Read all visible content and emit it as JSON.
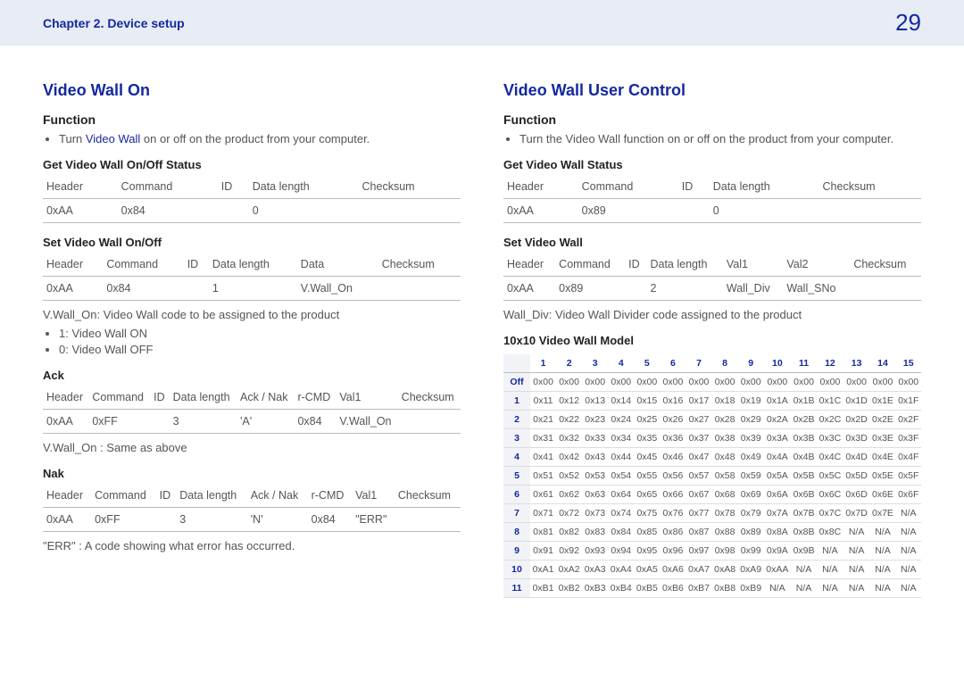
{
  "header": {
    "chapter": "Chapter 2. Device setup",
    "page": "29"
  },
  "left": {
    "title": "Video Wall On",
    "function_heading": "Function",
    "function_bullet_prefix": "Turn ",
    "function_bullet_brand": "Video Wall",
    "function_bullet_suffix": " on or off on the product from your computer.",
    "get_heading": "Get Video Wall On/Off Status",
    "get_headers": [
      "Header",
      "Command",
      "ID",
      "Data length",
      "Checksum"
    ],
    "get_row": [
      "0xAA",
      "0x84",
      "",
      "0",
      ""
    ],
    "set_heading": "Set Video Wall On/Off",
    "set_headers": [
      "Header",
      "Command",
      "ID",
      "Data length",
      "Data",
      "Checksum"
    ],
    "set_row": [
      "0xAA",
      "0x84",
      "",
      "1",
      "V.Wall_On",
      ""
    ],
    "set_note": "V.Wall_On: Video Wall code to be assigned to the product",
    "set_bullet1": "1: Video Wall ON",
    "set_bullet2": "0: Video Wall OFF",
    "ack_heading": "Ack",
    "ack_headers": [
      "Header",
      "Command",
      "ID",
      "Data length",
      "Ack / Nak",
      "r-CMD",
      "Val1",
      "Checksum"
    ],
    "ack_row": [
      "0xAA",
      "0xFF",
      "",
      "3",
      "'A'",
      "0x84",
      "V.Wall_On",
      ""
    ],
    "ack_note": "V.Wall_On : Same as above",
    "nak_heading": "Nak",
    "nak_headers": [
      "Header",
      "Command",
      "ID",
      "Data length",
      "Ack / Nak",
      "r-CMD",
      "Val1",
      "Checksum"
    ],
    "nak_row": [
      "0xAA",
      "0xFF",
      "",
      "3",
      "'N'",
      "0x84",
      "\"ERR\"",
      ""
    ],
    "nak_note": "\"ERR\" : A code showing what error has occurred."
  },
  "right": {
    "title": "Video Wall User Control",
    "function_heading": "Function",
    "function_bullet": "Turn the Video Wall function on or off on the product from your computer.",
    "get_heading": "Get Video Wall Status",
    "get_headers": [
      "Header",
      "Command",
      "ID",
      "Data length",
      "Checksum"
    ],
    "get_row": [
      "0xAA",
      "0x89",
      "",
      "0",
      ""
    ],
    "set_heading": "Set Video Wall",
    "set_headers": [
      "Header",
      "Command",
      "ID",
      "Data length",
      "Val1",
      "Val2",
      "Checksum"
    ],
    "set_row": [
      "0xAA",
      "0x89",
      "",
      "2",
      "Wall_Div",
      "Wall_SNo",
      ""
    ],
    "set_note": "Wall_Div: Video Wall Divider code assigned to the product",
    "model_heading": "10x10 Video Wall Model"
  },
  "matrix": {
    "col_headers": [
      "1",
      "2",
      "3",
      "4",
      "5",
      "6",
      "7",
      "8",
      "9",
      "10",
      "11",
      "12",
      "13",
      "14",
      "15"
    ],
    "row_headers": [
      "Off",
      "1",
      "2",
      "3",
      "4",
      "5",
      "6",
      "7",
      "8",
      "9",
      "10",
      "11"
    ]
  },
  "chart_data": {
    "type": "table",
    "title": "10x10 Video Wall Model",
    "columns": [
      "1",
      "2",
      "3",
      "4",
      "5",
      "6",
      "7",
      "8",
      "9",
      "10",
      "11",
      "12",
      "13",
      "14",
      "15"
    ],
    "row_labels": [
      "Off",
      "1",
      "2",
      "3",
      "4",
      "5",
      "6",
      "7",
      "8",
      "9",
      "10",
      "11"
    ],
    "rows": [
      [
        "0x00",
        "0x00",
        "0x00",
        "0x00",
        "0x00",
        "0x00",
        "0x00",
        "0x00",
        "0x00",
        "0x00",
        "0x00",
        "0x00",
        "0x00",
        "0x00",
        "0x00"
      ],
      [
        "0x11",
        "0x12",
        "0x13",
        "0x14",
        "0x15",
        "0x16",
        "0x17",
        "0x18",
        "0x19",
        "0x1A",
        "0x1B",
        "0x1C",
        "0x1D",
        "0x1E",
        "0x1F"
      ],
      [
        "0x21",
        "0x22",
        "0x23",
        "0x24",
        "0x25",
        "0x26",
        "0x27",
        "0x28",
        "0x29",
        "0x2A",
        "0x2B",
        "0x2C",
        "0x2D",
        "0x2E",
        "0x2F"
      ],
      [
        "0x31",
        "0x32",
        "0x33",
        "0x34",
        "0x35",
        "0x36",
        "0x37",
        "0x38",
        "0x39",
        "0x3A",
        "0x3B",
        "0x3C",
        "0x3D",
        "0x3E",
        "0x3F"
      ],
      [
        "0x41",
        "0x42",
        "0x43",
        "0x44",
        "0x45",
        "0x46",
        "0x47",
        "0x48",
        "0x49",
        "0x4A",
        "0x4B",
        "0x4C",
        "0x4D",
        "0x4E",
        "0x4F"
      ],
      [
        "0x51",
        "0x52",
        "0x53",
        "0x54",
        "0x55",
        "0x56",
        "0x57",
        "0x58",
        "0x59",
        "0x5A",
        "0x5B",
        "0x5C",
        "0x5D",
        "0x5E",
        "0x5F"
      ],
      [
        "0x61",
        "0x62",
        "0x63",
        "0x64",
        "0x65",
        "0x66",
        "0x67",
        "0x68",
        "0x69",
        "0x6A",
        "0x6B",
        "0x6C",
        "0x6D",
        "0x6E",
        "0x6F"
      ],
      [
        "0x71",
        "0x72",
        "0x73",
        "0x74",
        "0x75",
        "0x76",
        "0x77",
        "0x78",
        "0x79",
        "0x7A",
        "0x7B",
        "0x7C",
        "0x7D",
        "0x7E",
        "N/A"
      ],
      [
        "0x81",
        "0x82",
        "0x83",
        "0x84",
        "0x85",
        "0x86",
        "0x87",
        "0x88",
        "0x89",
        "0x8A",
        "0x8B",
        "0x8C",
        "N/A",
        "N/A",
        "N/A"
      ],
      [
        "0x91",
        "0x92",
        "0x93",
        "0x94",
        "0x95",
        "0x96",
        "0x97",
        "0x98",
        "0x99",
        "0x9A",
        "0x9B",
        "N/A",
        "N/A",
        "N/A",
        "N/A"
      ],
      [
        "0xA1",
        "0xA2",
        "0xA3",
        "0xA4",
        "0xA5",
        "0xA6",
        "0xA7",
        "0xA8",
        "0xA9",
        "0xAA",
        "N/A",
        "N/A",
        "N/A",
        "N/A",
        "N/A"
      ],
      [
        "0xB1",
        "0xB2",
        "0xB3",
        "0xB4",
        "0xB5",
        "0xB6",
        "0xB7",
        "0xB8",
        "0xB9",
        "N/A",
        "N/A",
        "N/A",
        "N/A",
        "N/A",
        "N/A"
      ]
    ]
  }
}
